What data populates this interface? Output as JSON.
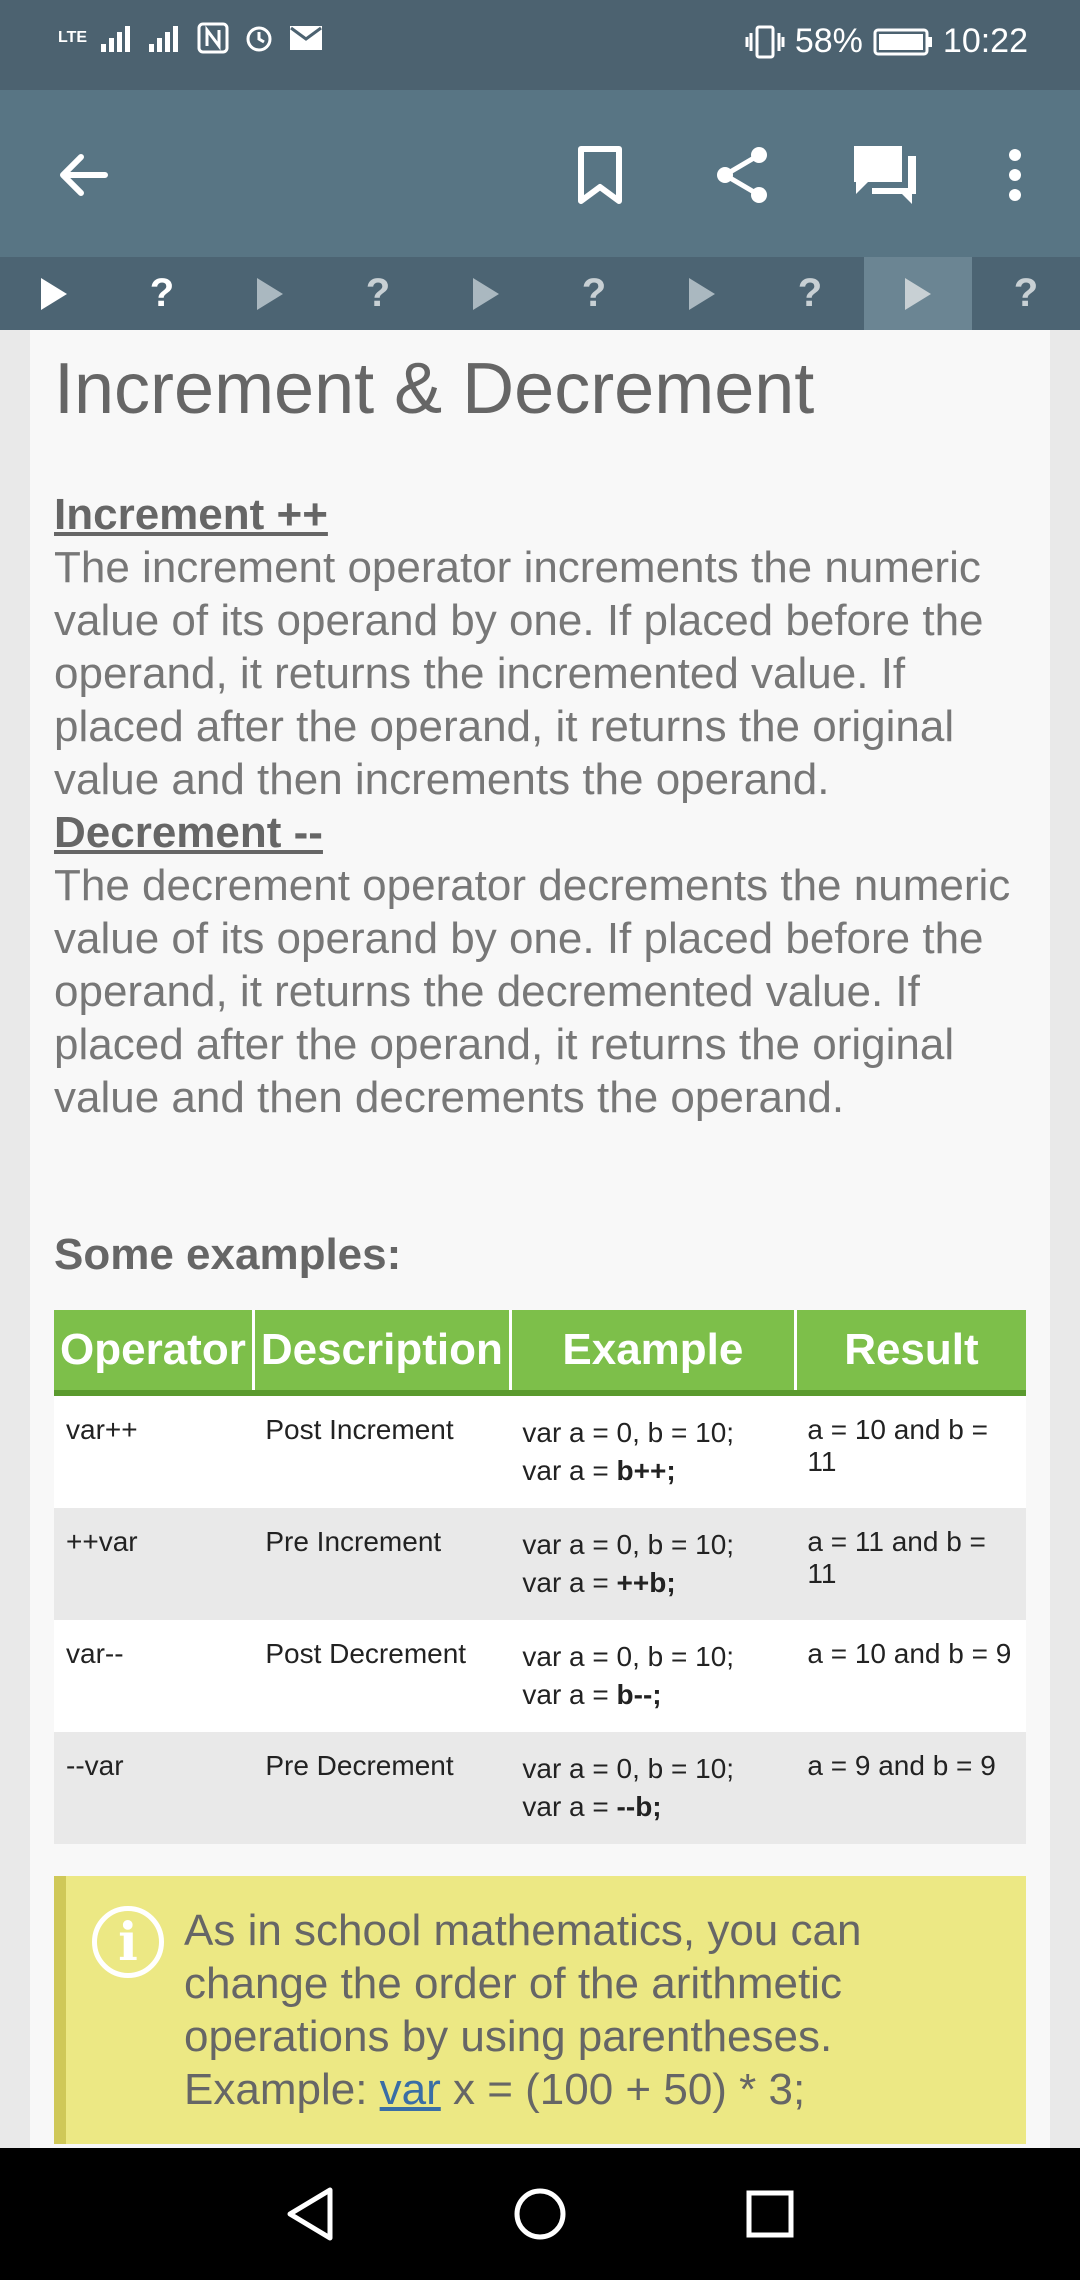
{
  "status_bar": {
    "network": "LTE",
    "battery": "58%",
    "time": "10:22",
    "icons": [
      "signal-icon",
      "signal-icon",
      "nfc-icon",
      "alarm-icon",
      "mail-icon",
      "vibrate-icon",
      "battery-icon"
    ]
  },
  "toolbar": {
    "icons": [
      "back-arrow-icon",
      "bookmark-icon",
      "share-icon",
      "comments-icon",
      "more-vert-icon"
    ]
  },
  "stepper": {
    "items": [
      {
        "type": "play",
        "label": "▶"
      },
      {
        "type": "quiz",
        "label": "?"
      },
      {
        "type": "play",
        "label": "▶"
      },
      {
        "type": "quiz",
        "label": "?"
      },
      {
        "type": "play",
        "label": "▶"
      },
      {
        "type": "quiz",
        "label": "?"
      },
      {
        "type": "play",
        "label": "▶"
      },
      {
        "type": "quiz",
        "label": "?"
      },
      {
        "type": "play",
        "label": "▶",
        "active": true
      },
      {
        "type": "quiz",
        "label": "?"
      }
    ]
  },
  "lesson": {
    "title": "Increment & Decrement",
    "increment_heading": "Increment ++",
    "increment_text": "The increment operator increments the numeric value of its operand by one. If placed before the operand, it returns the incremented value. If placed after the operand, it returns the original value and then increments the operand.",
    "decrement_heading": "Decrement --",
    "decrement_text": "The decrement operator decrements the numeric value of its operand by one. If placed before the operand, it returns the decremented value. If placed after the operand, it returns the original value and then decrements the operand.",
    "examples_heading": "Some examples:"
  },
  "table": {
    "headers": [
      "Operator",
      "Description",
      "Example",
      "Result"
    ],
    "rows": [
      {
        "operator": "var++",
        "description": "Post Increment",
        "example_1": "var a = 0, b = 10;",
        "example_2_prefix": "var a = ",
        "example_2_bold": "b++;",
        "result": "a = 10 and b = 11"
      },
      {
        "operator": "++var",
        "description": "Pre Increment",
        "example_1": "var a = 0, b = 10;",
        "example_2_prefix": "var a = ",
        "example_2_bold": "++b;",
        "result": "a = 11 and b = 11"
      },
      {
        "operator": "var--",
        "description": "Post Decrement",
        "example_1": "var a = 0, b = 10;",
        "example_2_prefix": "var a = ",
        "example_2_bold": "b--;",
        "result": "a = 10 and b = 9"
      },
      {
        "operator": "--var",
        "description": "Pre Decrement",
        "example_1": "var a = 0, b = 10;",
        "example_2_prefix": "var a = ",
        "example_2_bold": "--b;",
        "result": "a = 9 and b = 9"
      }
    ]
  },
  "note": {
    "icon": "info-icon",
    "text_before": "As in school mathematics, you can change the order of the arithmetic operations by using parentheses. Example: ",
    "link_text": "var",
    "text_after": " x = (100 + 50) * 3;"
  },
  "nav": {
    "icons": [
      "back-triangle-icon",
      "home-circle-icon",
      "recents-square-icon"
    ]
  },
  "colors": {
    "statusbar": "#4c6270",
    "toolbar": "#587584",
    "table_header": "#7dbf4a",
    "note_bg": "#ece884"
  }
}
